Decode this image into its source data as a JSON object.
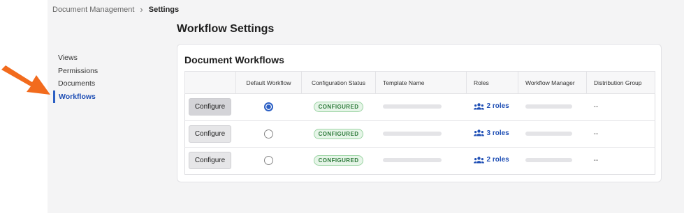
{
  "breadcrumb": {
    "parent": "Document Management",
    "current": "Settings"
  },
  "page_title": "Workflow Settings",
  "side_nav": {
    "items": [
      {
        "label": "Views"
      },
      {
        "label": "Permissions"
      },
      {
        "label": "Documents"
      },
      {
        "label": "Workflows",
        "active": true
      }
    ]
  },
  "card": {
    "title": "Document Workflows",
    "columns": {
      "action": "",
      "default": "Default Workflow",
      "status": "Configuration Status",
      "template": "Template Name",
      "roles": "Roles",
      "manager": "Workflow Manager",
      "group": "Distribution Group"
    },
    "rows": [
      {
        "button": "Configure",
        "default": true,
        "status": "CONFIGURED",
        "roles": "2 roles",
        "group": "--"
      },
      {
        "button": "Configure",
        "default": false,
        "status": "CONFIGURED",
        "roles": "3 roles",
        "group": "--"
      },
      {
        "button": "Configure",
        "default": false,
        "status": "CONFIGURED",
        "roles": "2 roles",
        "group": "--"
      }
    ]
  },
  "colors": {
    "accent": "#2b5fc4",
    "badge_green": "#2d7a3a",
    "arrow": "#f26b1d"
  }
}
